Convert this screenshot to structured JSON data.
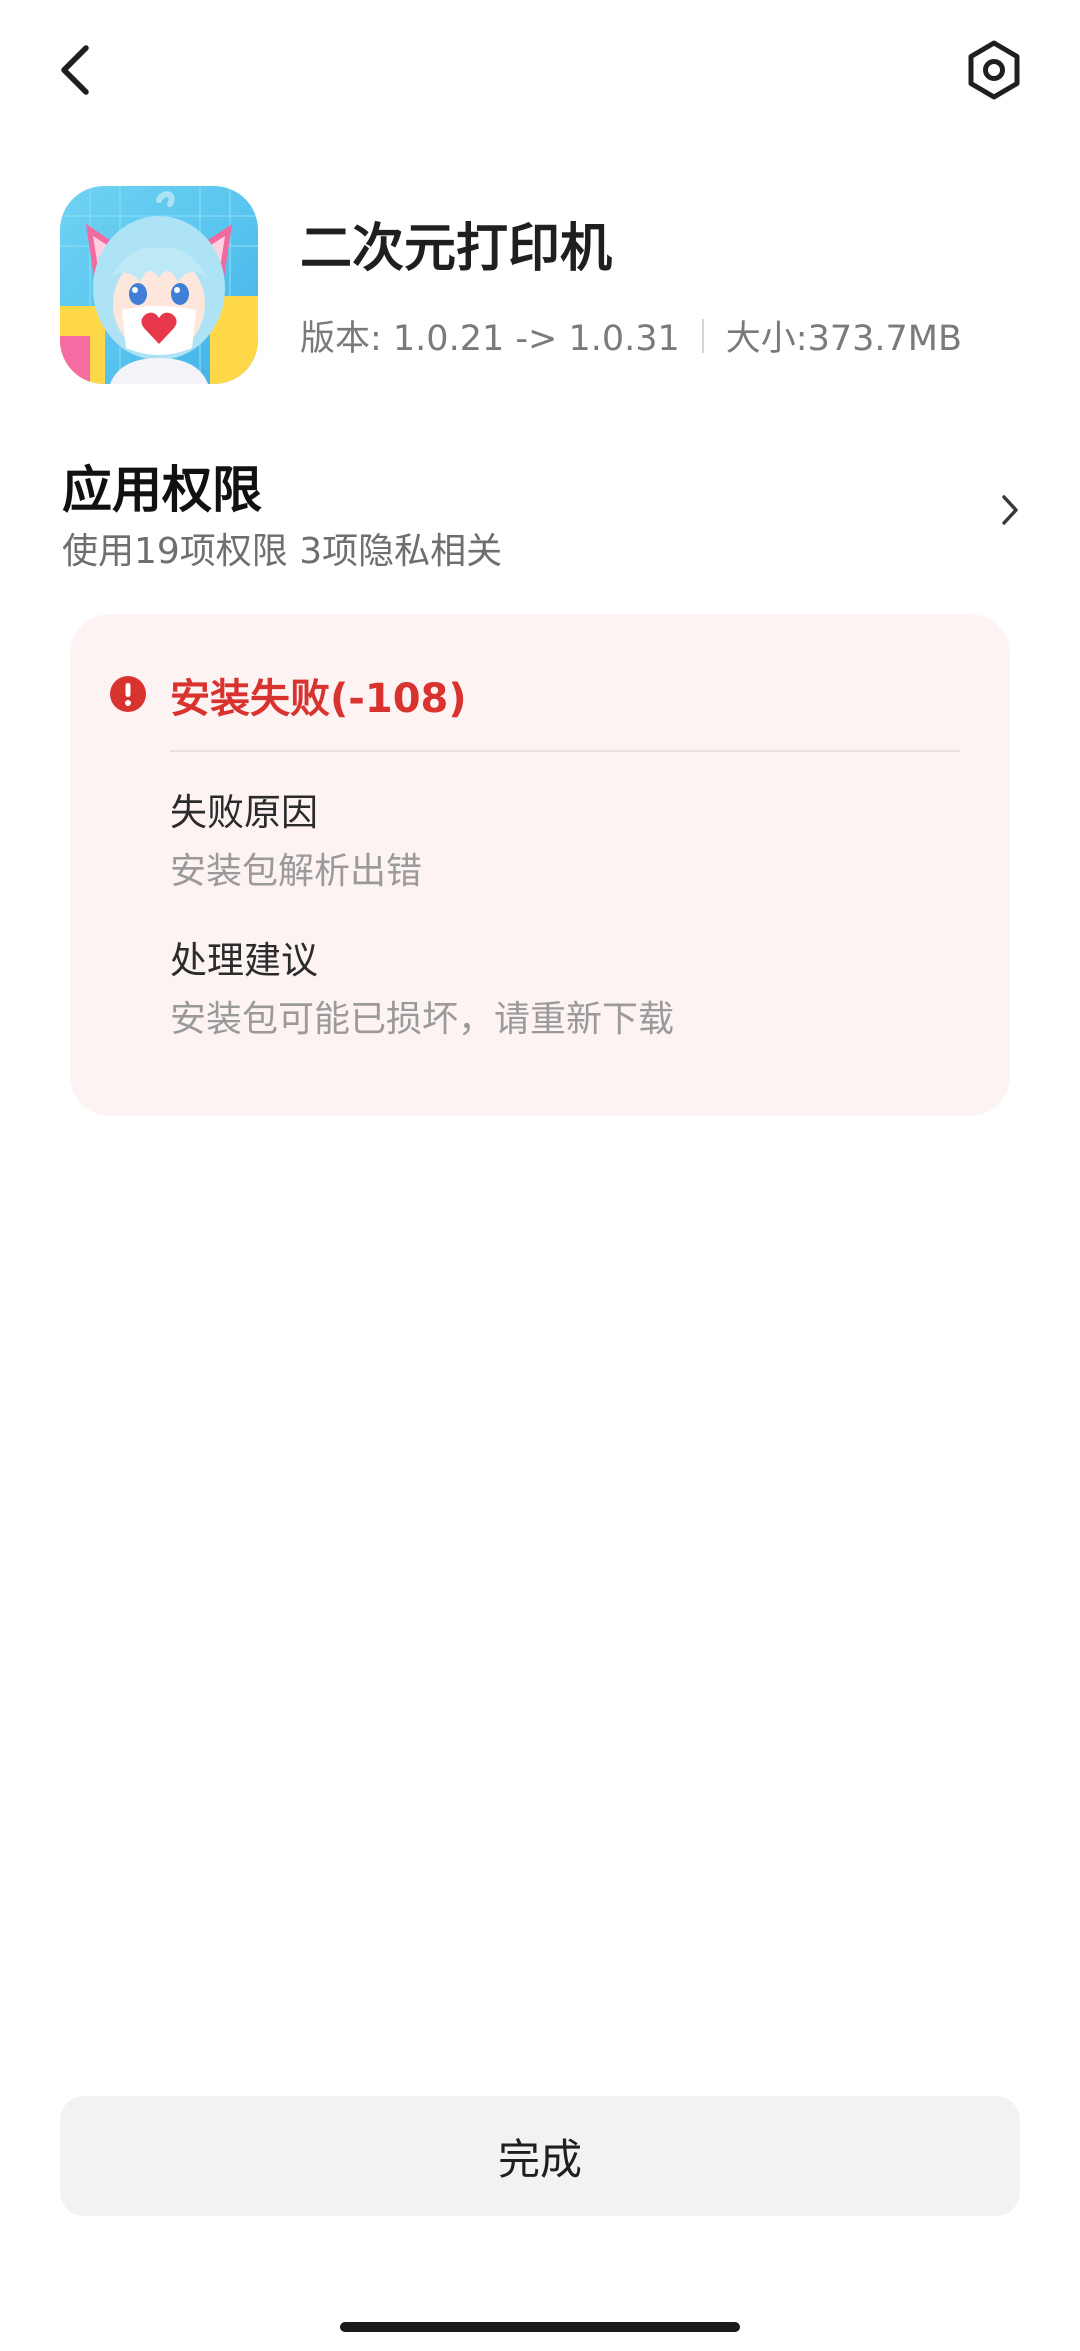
{
  "topbar": {
    "back_icon": "chevron-left-icon",
    "settings_icon": "hexagon-gear-icon"
  },
  "app": {
    "icon": "anime-girl-app-icon",
    "name": "二次元打印机",
    "version_text": "版本: 1.0.21 -> 1.0.31",
    "size_text": "大小:373.7MB"
  },
  "permissions": {
    "title": "应用权限",
    "summary": "使用19项权限 3项隐私相关",
    "chevron_icon": "chevron-right-icon"
  },
  "error": {
    "icon": "error-circle-icon",
    "title": "安装失败(-108)",
    "reason_label": "失败原因",
    "reason_value": "安装包解析出错",
    "suggestion_label": "处理建议",
    "suggestion_value": "安装包可能已损坏，请重新下载",
    "accent_color": "#d8332f",
    "card_bg": "#fdf3f3"
  },
  "footer": {
    "done_label": "完成"
  }
}
